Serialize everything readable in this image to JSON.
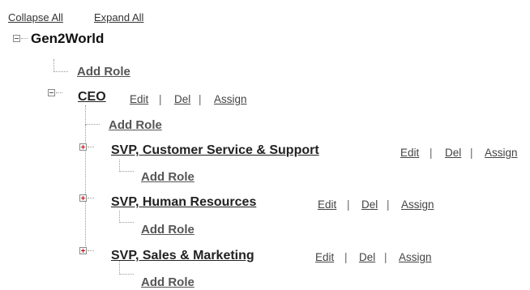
{
  "toolbar": {
    "collapse_all": "Collapse All",
    "expand_all": "Expand All"
  },
  "tree": {
    "root": {
      "label": "Gen2World",
      "add_role": "Add Role"
    },
    "ceo": {
      "label": "CEO",
      "edit": "Edit",
      "del": "Del",
      "assign": "Assign",
      "add_role": "Add Role"
    },
    "children": [
      {
        "label": "SVP, Customer Service & Support",
        "edit": "Edit",
        "del": "Del",
        "assign": "Assign",
        "add_role": "Add Role"
      },
      {
        "label": "SVP, Human Resources",
        "edit": "Edit",
        "del": "Del",
        "assign": "Assign",
        "add_role": "Add Role"
      },
      {
        "label": "SVP, Sales & Marketing",
        "edit": "Edit",
        "del": "Del",
        "assign": "Assign",
        "add_role": "Add Role"
      }
    ],
    "separator": "|"
  },
  "colors": {
    "expand_plus": "#cc0000",
    "tree_lines": "#9a9a9a",
    "link_text": "#444444"
  }
}
